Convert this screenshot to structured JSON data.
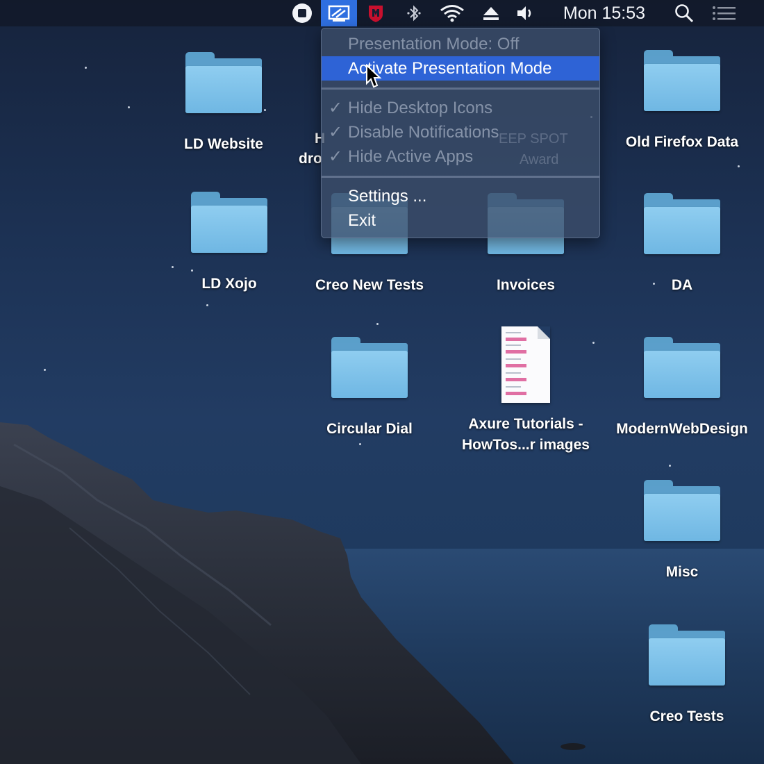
{
  "menubar": {
    "clock": "Mon 15:53",
    "icons": [
      "stop-record-icon",
      "presentation-mode-icon",
      "mcafee-icon",
      "bluetooth-icon",
      "wifi-icon",
      "eject-icon",
      "volume-icon",
      "spotlight-search-icon",
      "notification-center-icon"
    ]
  },
  "menu": {
    "status": "Presentation Mode: Off",
    "activate": "Activate Presentation Mode",
    "options": [
      {
        "check": "✓",
        "label": "Hide Desktop Icons"
      },
      {
        "check": "✓",
        "label": "Disable Notifications"
      },
      {
        "check": "✓",
        "label": "Hide Active Apps"
      }
    ],
    "settings": "Settings ...",
    "exit": "Exit"
  },
  "desktop": {
    "icons": [
      {
        "label": "LD Website",
        "type": "folder"
      },
      {
        "label": "Old Firefox Data",
        "type": "folder"
      },
      {
        "label": "LD Xojo",
        "type": "folder"
      },
      {
        "label": "Creo New Tests",
        "type": "folder"
      },
      {
        "label": "Invoices",
        "type": "folder"
      },
      {
        "label": "DA",
        "type": "folder"
      },
      {
        "label": "Circular Dial",
        "type": "folder"
      },
      {
        "label": "Axure Tutorials -\nHowTos...r images",
        "type": "document"
      },
      {
        "label": "ModernWebDesign",
        "type": "folder"
      },
      {
        "label": "Misc",
        "type": "folder"
      },
      {
        "label": "Creo Tests",
        "type": "folder"
      }
    ],
    "partial_labels": [
      "H",
      "dro"
    ],
    "ghost_labels": [
      "EEP SPOT",
      "Award"
    ]
  },
  "colors": {
    "menu_highlight": "#2e63d6",
    "menubar_active": "#2f6fe0",
    "folder": "#7cc0ea"
  }
}
